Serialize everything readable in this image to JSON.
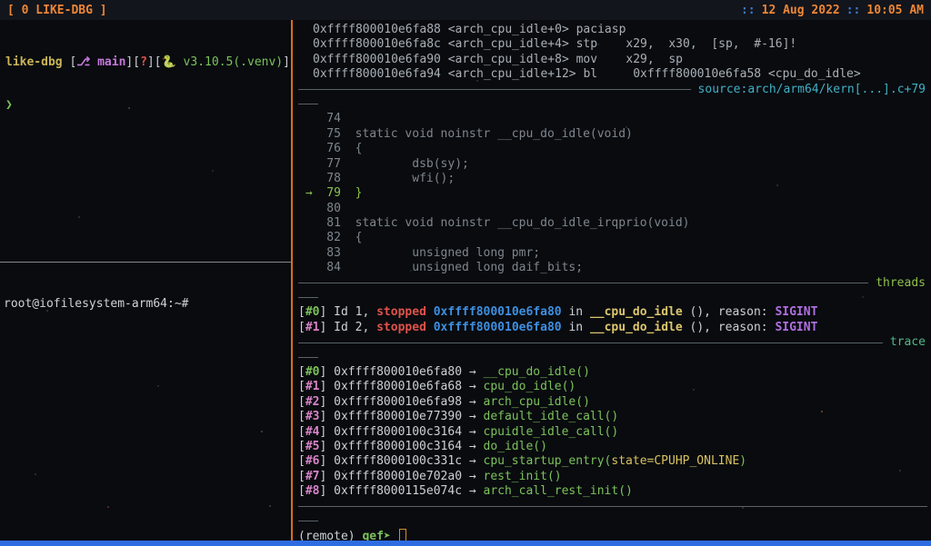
{
  "statusbar": {
    "session_label": "[ 0 LIKE-DBG ]",
    "clock_sep1": "::",
    "clock_date": "12 Aug 2022",
    "clock_sep2": "::",
    "clock_time": "10:05 AM"
  },
  "colors": {
    "accent_orange": "#dd6a1c",
    "status_orange": "#ee8637",
    "status_blue": "#3d7bd8",
    "green": "#7cc25b",
    "red": "#e0524a",
    "blue": "#3e8fe0",
    "purple": "#b06fe0",
    "pink": "#d884c8",
    "yellow": "#ddc66c",
    "cyan": "#41b0c4",
    "bottom_bar_blue": "#2e6ce2"
  },
  "left_pane": {
    "prompt": {
      "project": "like-dbg",
      "seg1_open": " [",
      "branch": "⎇ main",
      "seg1_close": "][",
      "flag": "?",
      "seg2_close": "][",
      "python": "🐍 v3.10.5(.venv)",
      "seg3_close": "]",
      "caret": "❯"
    },
    "root_prompt": "root@iofilesystem-arm64:~#"
  },
  "gdb": {
    "assembly": [
      {
        "address": "0xffff800010e6fa88",
        "symbol": "<arch_cpu_idle+0>",
        "code": "paciasp"
      },
      {
        "address": "0xffff800010e6fa8c",
        "symbol": "<arch_cpu_idle+4>",
        "code": "stp    x29,  x30,  [sp,  #-16]!"
      },
      {
        "address": "0xffff800010e6fa90",
        "symbol": "<arch_cpu_idle+8>",
        "code": "mov    x29,  sp"
      },
      {
        "address": "0xffff800010e6fa94",
        "symbol": "<arch_cpu_idle+12>",
        "code": "bl     0xffff800010e6fa58 <cpu_do_idle>"
      }
    ],
    "sections": {
      "source_title": "source:arch/arm64/kern[...].c+79",
      "threads_title": "threads",
      "trace_title": "trace"
    },
    "source": {
      "current_line": 79,
      "marker": "→",
      "lines": [
        {
          "num": 74,
          "code": ""
        },
        {
          "num": 75,
          "code": "static void noinstr __cpu_do_idle(void)"
        },
        {
          "num": 76,
          "code": "{"
        },
        {
          "num": 77,
          "code": "        dsb(sy);"
        },
        {
          "num": 78,
          "code": "        wfi();"
        },
        {
          "num": 79,
          "code": "}"
        },
        {
          "num": 80,
          "code": ""
        },
        {
          "num": 81,
          "code": "static void noinstr __cpu_do_idle_irqprio(void)"
        },
        {
          "num": 82,
          "code": "{"
        },
        {
          "num": 83,
          "code": "        unsigned long pmr;"
        },
        {
          "num": 84,
          "code": "        unsigned long daif_bits;"
        }
      ]
    },
    "labels": {
      "in_label": "in",
      "reason_label": "(), reason:"
    },
    "threads": [
      {
        "frame": "#0",
        "id_text": "Id 1,",
        "status": "stopped",
        "address": "0xffff800010e6fa80",
        "func": "__cpu_do_idle",
        "reason": "SIGINT"
      },
      {
        "frame": "#1",
        "id_text": "Id 2,",
        "status": "stopped",
        "address": "0xffff800010e6fa80",
        "func": "__cpu_do_idle",
        "reason": "SIGINT"
      }
    ],
    "trace_arrow": "→",
    "trace": [
      {
        "frame": "#0",
        "address": "0xffff800010e6fa80",
        "func": "__cpu_do_idle",
        "args": ""
      },
      {
        "frame": "#1",
        "address": "0xffff800010e6fa68",
        "func": "cpu_do_idle",
        "args": ""
      },
      {
        "frame": "#2",
        "address": "0xffff800010e6fa98",
        "func": "arch_cpu_idle",
        "args": ""
      },
      {
        "frame": "#3",
        "address": "0xffff800010e77390",
        "func": "default_idle_call",
        "args": ""
      },
      {
        "frame": "#4",
        "address": "0xffff8000100c3164",
        "func": "cpuidle_idle_call",
        "args": ""
      },
      {
        "frame": "#5",
        "address": "0xffff8000100c3164",
        "func": "do_idle",
        "args": ""
      },
      {
        "frame": "#6",
        "address": "0xffff8000100c331c",
        "func": "cpu_startup_entry",
        "args": "state=CPUHP_ONLINE"
      },
      {
        "frame": "#7",
        "address": "0xffff800010e702a0",
        "func": "rest_init",
        "args": ""
      },
      {
        "frame": "#8",
        "address": "0xffff8000115e074c",
        "func": "arch_call_rest_init",
        "args": ""
      }
    ],
    "prompt": {
      "mode": "(remote)",
      "gef": "gef",
      "arrow": "➤"
    }
  }
}
